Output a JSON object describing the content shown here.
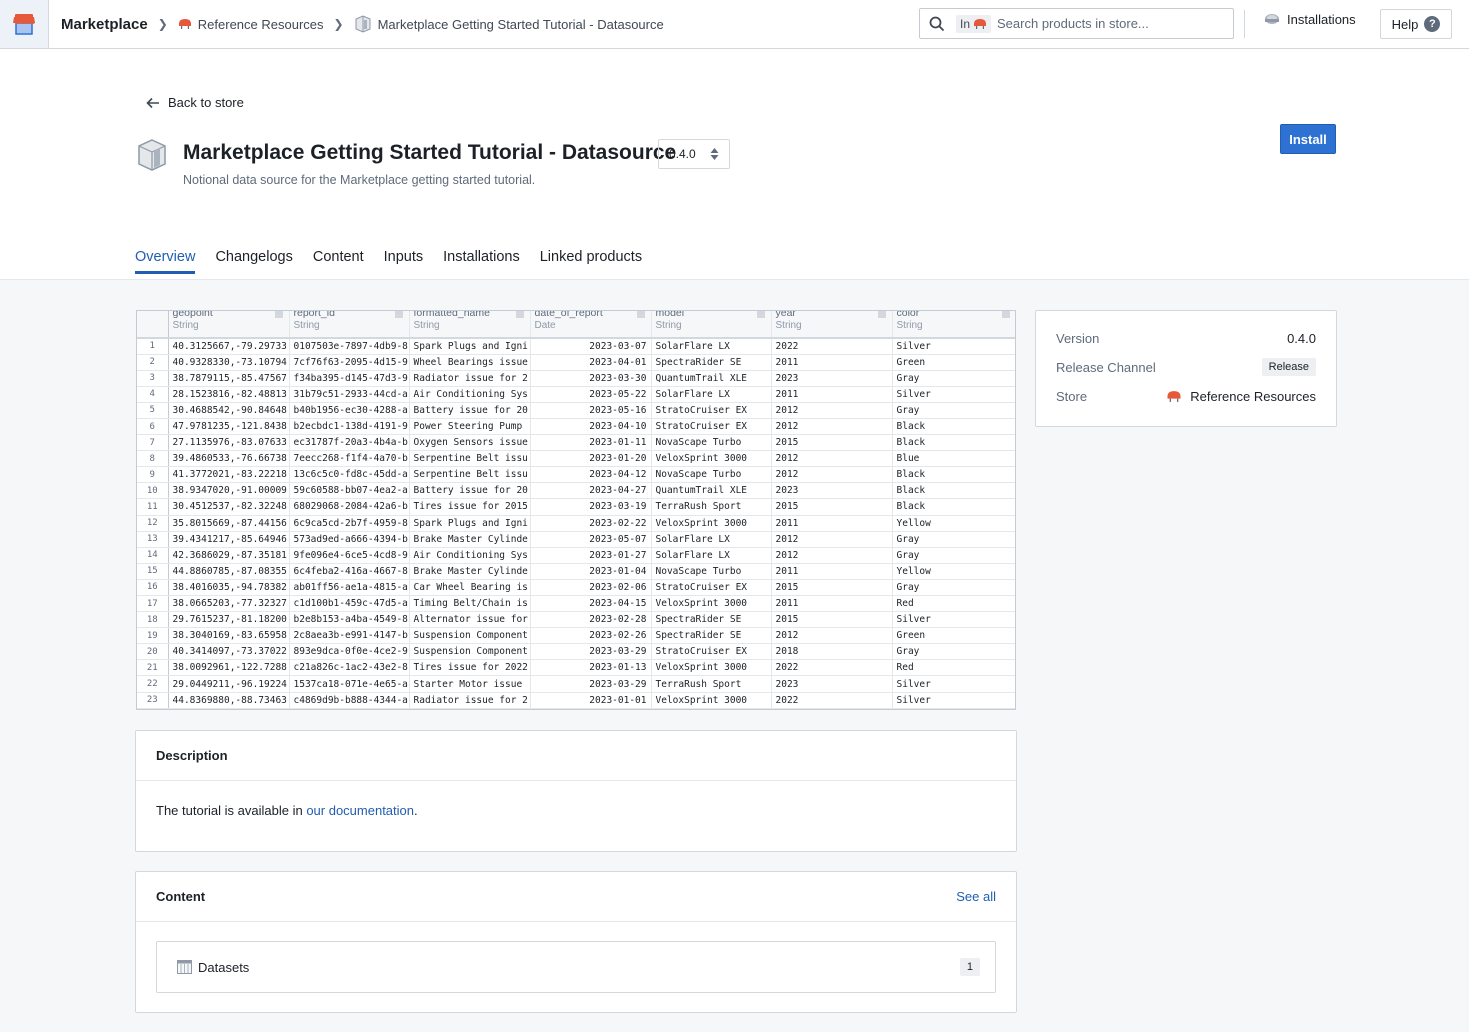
{
  "topbar": {
    "app_name": "Marketplace",
    "breadcrumbs": [
      "Reference Resources",
      "Marketplace Getting Started Tutorial - Datasource"
    ],
    "search": {
      "scope_label": "In",
      "placeholder": "Search products in store..."
    },
    "installations_label": "Installations",
    "help_label": "Help"
  },
  "header": {
    "back_label": "Back to store",
    "title": "Marketplace Getting Started Tutorial - Datasource",
    "version": "0.4.0",
    "subtitle": "Notional data source for the Marketplace getting started tutorial.",
    "install_label": "Install"
  },
  "tabs": [
    {
      "label": "Overview",
      "active": true
    },
    {
      "label": "Changelogs",
      "active": false
    },
    {
      "label": "Content",
      "active": false
    },
    {
      "label": "Inputs",
      "active": false
    },
    {
      "label": "Installations",
      "active": false
    },
    {
      "label": "Linked products",
      "active": false
    }
  ],
  "preview_table": {
    "columns": [
      {
        "name": "geopoint",
        "type": "String"
      },
      {
        "name": "report_id",
        "type": "String"
      },
      {
        "name": "formatted_name",
        "type": "String"
      },
      {
        "name": "date_of_report",
        "type": "Date"
      },
      {
        "name": "model",
        "type": "String"
      },
      {
        "name": "year",
        "type": "String"
      },
      {
        "name": "color",
        "type": "String"
      }
    ],
    "rows": [
      [
        "40.3125667,-79.29733",
        "0107503e-7897-4db9-8",
        "Spark Plugs and Igni",
        "2023-03-07",
        "SolarFlare LX",
        "2022",
        "Silver"
      ],
      [
        "40.9328330,-73.10794",
        "7cf76f63-2095-4d15-9",
        "Wheel Bearings issue",
        "2023-04-01",
        "SpectraRider SE",
        "2011",
        "Green"
      ],
      [
        "38.7879115,-85.47567",
        "f34ba395-d145-47d3-9",
        "Radiator issue for 2",
        "2023-03-30",
        "QuantumTrail XLE",
        "2023",
        "Gray"
      ],
      [
        "28.1523816,-82.48813",
        "31b79c51-2933-44cd-a",
        "Air Conditioning Sys",
        "2023-05-22",
        "SolarFlare LX",
        "2011",
        "Silver"
      ],
      [
        "30.4688542,-90.84648",
        "b40b1956-ec30-4288-a",
        "Battery issue for 20",
        "2023-05-16",
        "StratoCruiser EX",
        "2012",
        "Gray"
      ],
      [
        "47.9781235,-121.8438",
        "b2ecbdc1-138d-4191-9",
        "Power Steering Pump ",
        "2023-04-10",
        "StratoCruiser EX",
        "2012",
        "Black"
      ],
      [
        "27.1135976,-83.07633",
        "ec31787f-20a3-4b4a-b",
        "Oxygen Sensors issue",
        "2023-01-11",
        "NovaScape Turbo",
        "2015",
        "Black"
      ],
      [
        "39.4860533,-76.66738",
        "7eecc268-f1f4-4a70-b",
        "Serpentine Belt issu",
        "2023-01-20",
        "VeloxSprint 3000",
        "2012",
        "Blue"
      ],
      [
        "41.3772021,-83.22218",
        "13c6c5c0-fd8c-45dd-a",
        "Serpentine Belt issu",
        "2023-04-12",
        "NovaScape Turbo",
        "2012",
        "Black"
      ],
      [
        "38.9347020,-91.00009",
        "59c60588-bb07-4ea2-a",
        "Battery issue for 20",
        "2023-04-27",
        "QuantumTrail XLE",
        "2023",
        "Black"
      ],
      [
        "30.4512537,-82.32248",
        "68029068-2084-42a6-b",
        "Tires issue for 2015",
        "2023-03-19",
        "TerraRush Sport",
        "2015",
        "Black"
      ],
      [
        "35.8015669,-87.44156",
        "6c9ca5cd-2b7f-4959-8",
        "Spark Plugs and Igni",
        "2023-02-22",
        "VeloxSprint 3000",
        "2011",
        "Yellow"
      ],
      [
        "39.4341217,-85.64946",
        "573ad9ed-a666-4394-b",
        "Brake Master Cylinde",
        "2023-05-07",
        "SolarFlare LX",
        "2012",
        "Gray"
      ],
      [
        "42.3686029,-87.35181",
        "9fe096e4-6ce5-4cd8-9",
        "Air Conditioning Sys",
        "2023-01-27",
        "SolarFlare LX",
        "2012",
        "Gray"
      ],
      [
        "44.8860785,-87.08355",
        "6c4feba2-416a-4667-8",
        "Brake Master Cylinde",
        "2023-01-04",
        "NovaScape Turbo",
        "2011",
        "Yellow"
      ],
      [
        "38.4016035,-94.78382",
        "ab01ff56-ae1a-4815-a",
        "Car Wheel Bearing is",
        "2023-02-06",
        "StratoCruiser EX",
        "2015",
        "Gray"
      ],
      [
        "38.0665203,-77.32327",
        "c1d100b1-459c-47d5-a",
        "Timing Belt/Chain is",
        "2023-04-15",
        "VeloxSprint 3000",
        "2011",
        "Red"
      ],
      [
        "29.7615237,-81.18200",
        "b2e8b153-a4ba-4549-8",
        "Alternator issue for",
        "2023-02-28",
        "SpectraRider SE",
        "2015",
        "Silver"
      ],
      [
        "38.3040169,-83.65958",
        "2c8aea3b-e991-4147-b",
        "Suspension Component",
        "2023-02-26",
        "SpectraRider SE",
        "2012",
        "Green"
      ],
      [
        "40.3414097,-73.37022",
        "893e9dca-0f0e-4ce2-9",
        "Suspension Component",
        "2023-03-29",
        "StratoCruiser EX",
        "2018",
        "Gray"
      ],
      [
        "38.0092961,-122.7288",
        "c21a826c-1ac2-43e2-8",
        "Tires issue for 2022",
        "2023-01-13",
        "VeloxSprint 3000",
        "2022",
        "Red"
      ],
      [
        "29.0449211,-96.19224",
        "1537ca18-071e-4e65-a",
        "Starter Motor issue ",
        "2023-03-29",
        "TerraRush Sport",
        "2023",
        "Silver"
      ],
      [
        "44.8369880,-88.73463",
        "c4869d9b-b888-4344-a",
        "Radiator issue for 2",
        "2023-01-01",
        "VeloxSprint 3000",
        "2022",
        "Silver"
      ]
    ]
  },
  "meta": {
    "version_label": "Version",
    "version_value": "0.4.0",
    "channel_label": "Release Channel",
    "channel_value": "Release",
    "store_label": "Store",
    "store_value": "Reference Resources"
  },
  "description": {
    "heading": "Description",
    "text_before": "The tutorial is available in ",
    "link_text": "our documentation",
    "text_after": "."
  },
  "content": {
    "heading": "Content",
    "see_all": "See all",
    "items": [
      {
        "label": "Datasets",
        "count": "1"
      }
    ]
  },
  "colors": {
    "accent": "#215db0",
    "primary_button": "#2d72d2",
    "store_icon": "#e5583a"
  }
}
